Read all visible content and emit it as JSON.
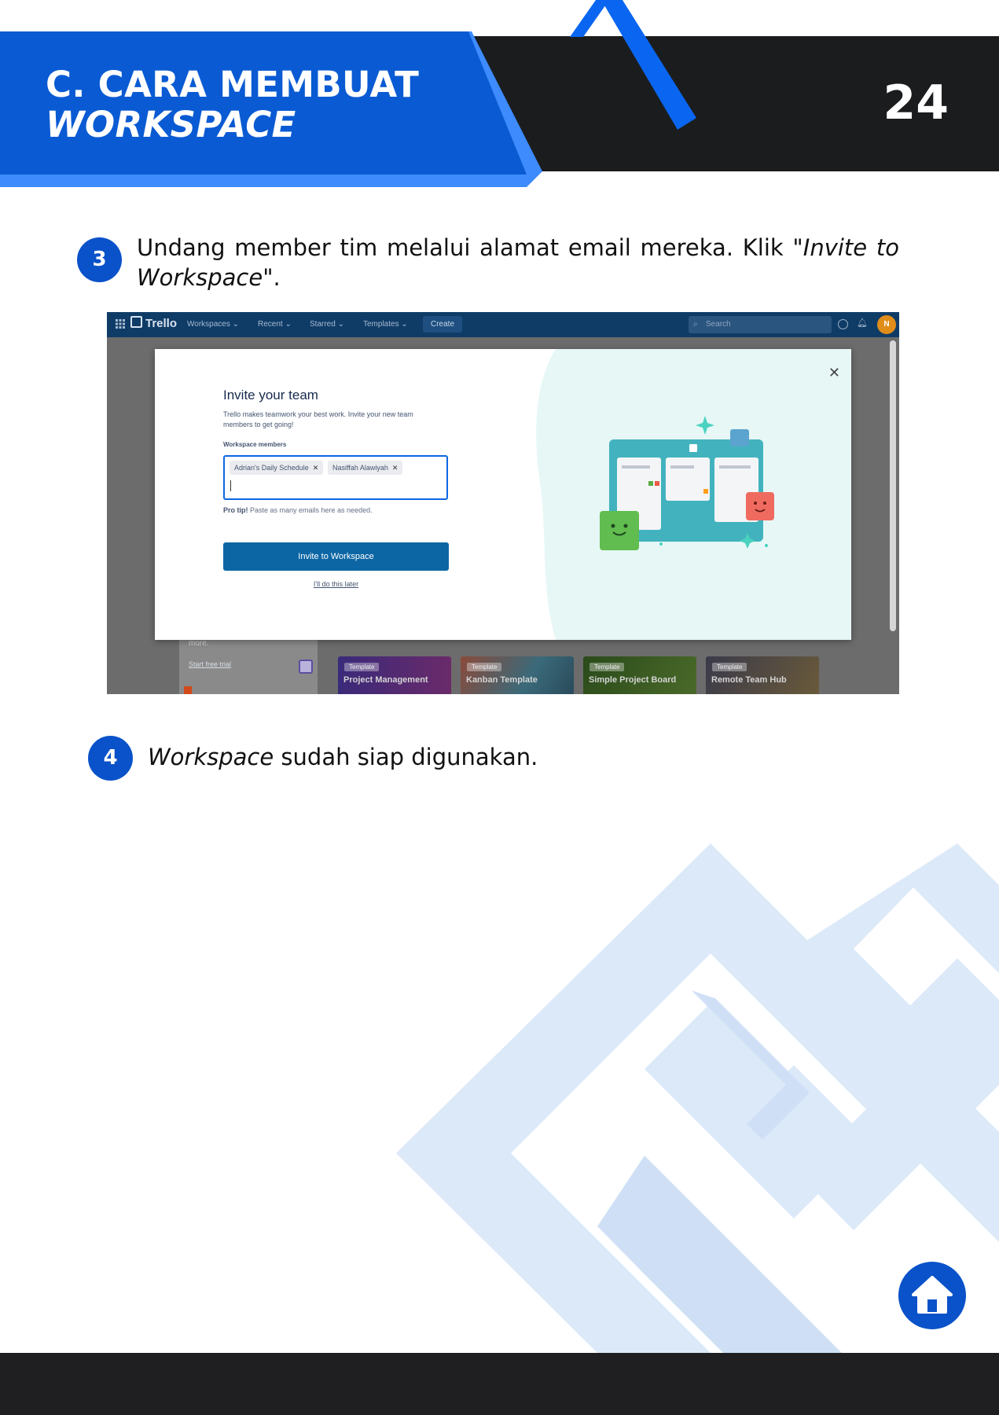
{
  "header": {
    "title_line1": "C. CARA MEMBUAT",
    "title_line2": "WORKSPACE",
    "page_number": "24"
  },
  "steps": [
    {
      "number": "3",
      "text_before": "Undang member tim melalui alamat email mereka. Klik \"",
      "text_italic": "Invite to Workspace\"",
      "text_after": "."
    },
    {
      "number": "4",
      "text_italic": "Workspace",
      "text_after": " sudah siap digunakan."
    }
  ],
  "screenshot": {
    "topbar": {
      "logo": "Trello",
      "nav": [
        "Workspaces",
        "Recent",
        "Starred",
        "Templates"
      ],
      "create_label": "Create",
      "search_placeholder": "Search",
      "avatar_initial": "N"
    },
    "modal": {
      "title": "Invite your team",
      "description": "Trello makes teamwork your best work. Invite your new team members to get going!",
      "members_label": "Workspace members",
      "chips": [
        "Adrian's Daily Schedule",
        "Nasiffah Alawiyah"
      ],
      "chip_remove_glyph": "✕",
      "pro_tip_bold": "Pro tip!",
      "pro_tip_text": " Paste as many emails here as needed.",
      "invite_button": "Invite to Workspace",
      "later_link": "I'll do this later",
      "close_glyph": "✕"
    },
    "behind": {
      "more_text": "more.",
      "start_link": "Start free trial",
      "template_tag": "Template",
      "templates": [
        "Project Management",
        "Kanban Template",
        "Simple Project Board",
        "Remote Team Hub"
      ]
    }
  },
  "colors": {
    "brand_blue": "#0a5bd3",
    "light_blue": "#3d8bfd",
    "dark": "#1b1c1e",
    "badge_blue": "#0a52c9"
  },
  "icons": {
    "home": "home-icon"
  }
}
